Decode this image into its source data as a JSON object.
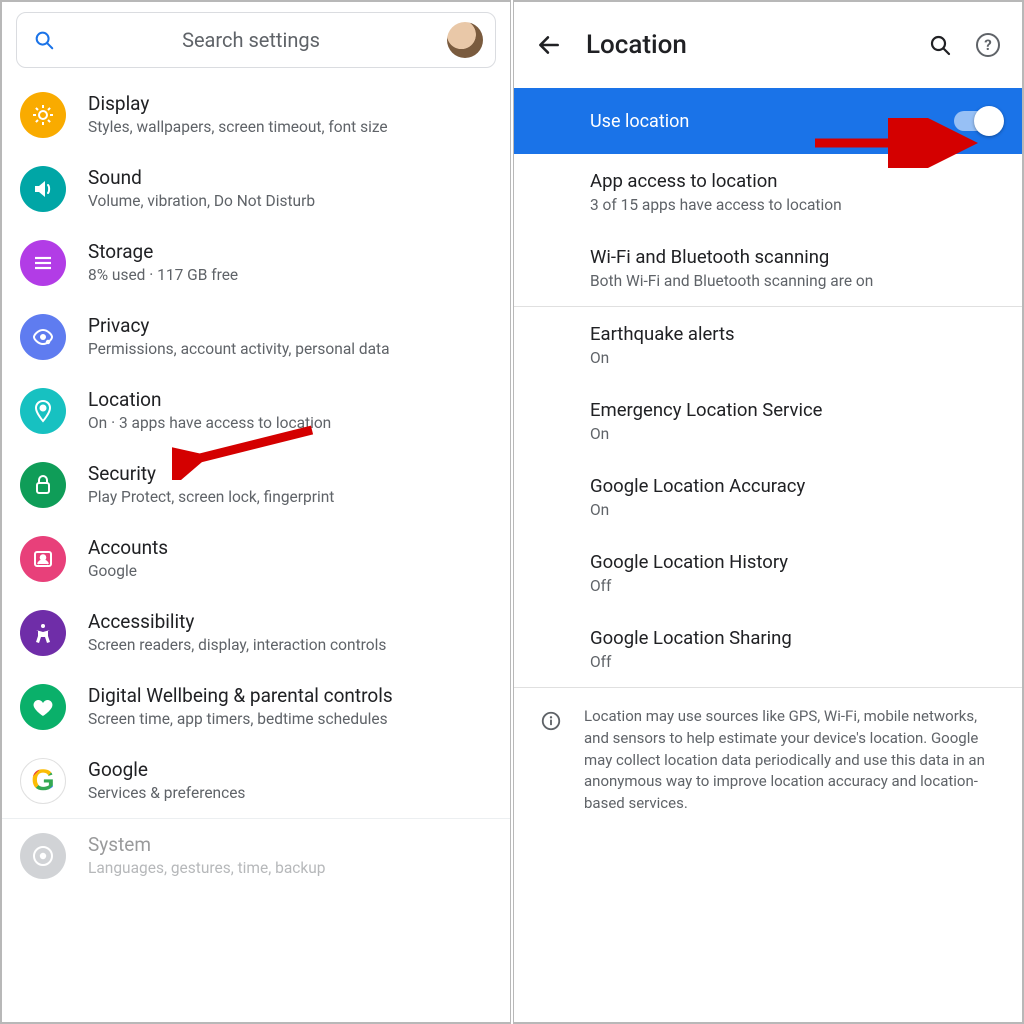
{
  "left": {
    "search_placeholder": "Search settings",
    "items": [
      {
        "id": "display",
        "title": "Display",
        "sub": "Styles, wallpapers, screen timeout, font size"
      },
      {
        "id": "sound",
        "title": "Sound",
        "sub": "Volume, vibration, Do Not Disturb"
      },
      {
        "id": "storage",
        "title": "Storage",
        "sub": "8% used · 117 GB free"
      },
      {
        "id": "privacy",
        "title": "Privacy",
        "sub": "Permissions, account activity, personal data"
      },
      {
        "id": "location",
        "title": "Location",
        "sub": "On · 3 apps have access to location"
      },
      {
        "id": "security",
        "title": "Security",
        "sub": "Play Protect, screen lock, fingerprint"
      },
      {
        "id": "accounts",
        "title": "Accounts",
        "sub": "Google"
      },
      {
        "id": "a11y",
        "title": "Accessibility",
        "sub": "Screen readers, display, interaction controls"
      },
      {
        "id": "wellbeing",
        "title": "Digital Wellbeing & parental controls",
        "sub": "Screen time, app timers, bedtime schedules"
      },
      {
        "id": "google",
        "title": "Google",
        "sub": "Services & preferences"
      },
      {
        "id": "system",
        "title": "System",
        "sub": "Languages, gestures, time, backup"
      }
    ]
  },
  "right": {
    "title": "Location",
    "use_location_label": "Use location",
    "use_location_on": true,
    "sections": [
      {
        "title": "App access to location",
        "sub": "3 of 15 apps have access to location"
      },
      {
        "title": "Wi-Fi and Bluetooth scanning",
        "sub": "Both Wi-Fi and Bluetooth scanning are on"
      }
    ],
    "services": [
      {
        "title": "Earthquake alerts",
        "sub": "On"
      },
      {
        "title": "Emergency Location Service",
        "sub": "On"
      },
      {
        "title": "Google Location Accuracy",
        "sub": "On"
      },
      {
        "title": "Google Location History",
        "sub": "Off"
      },
      {
        "title": "Google Location Sharing",
        "sub": "Off"
      }
    ],
    "footnote": "Location may use sources like GPS, Wi-Fi, mobile networks, and sensors to help estimate your device's location. Google may collect location data periodically and use this data in an anonymous way to improve location accuracy and location-based services."
  }
}
